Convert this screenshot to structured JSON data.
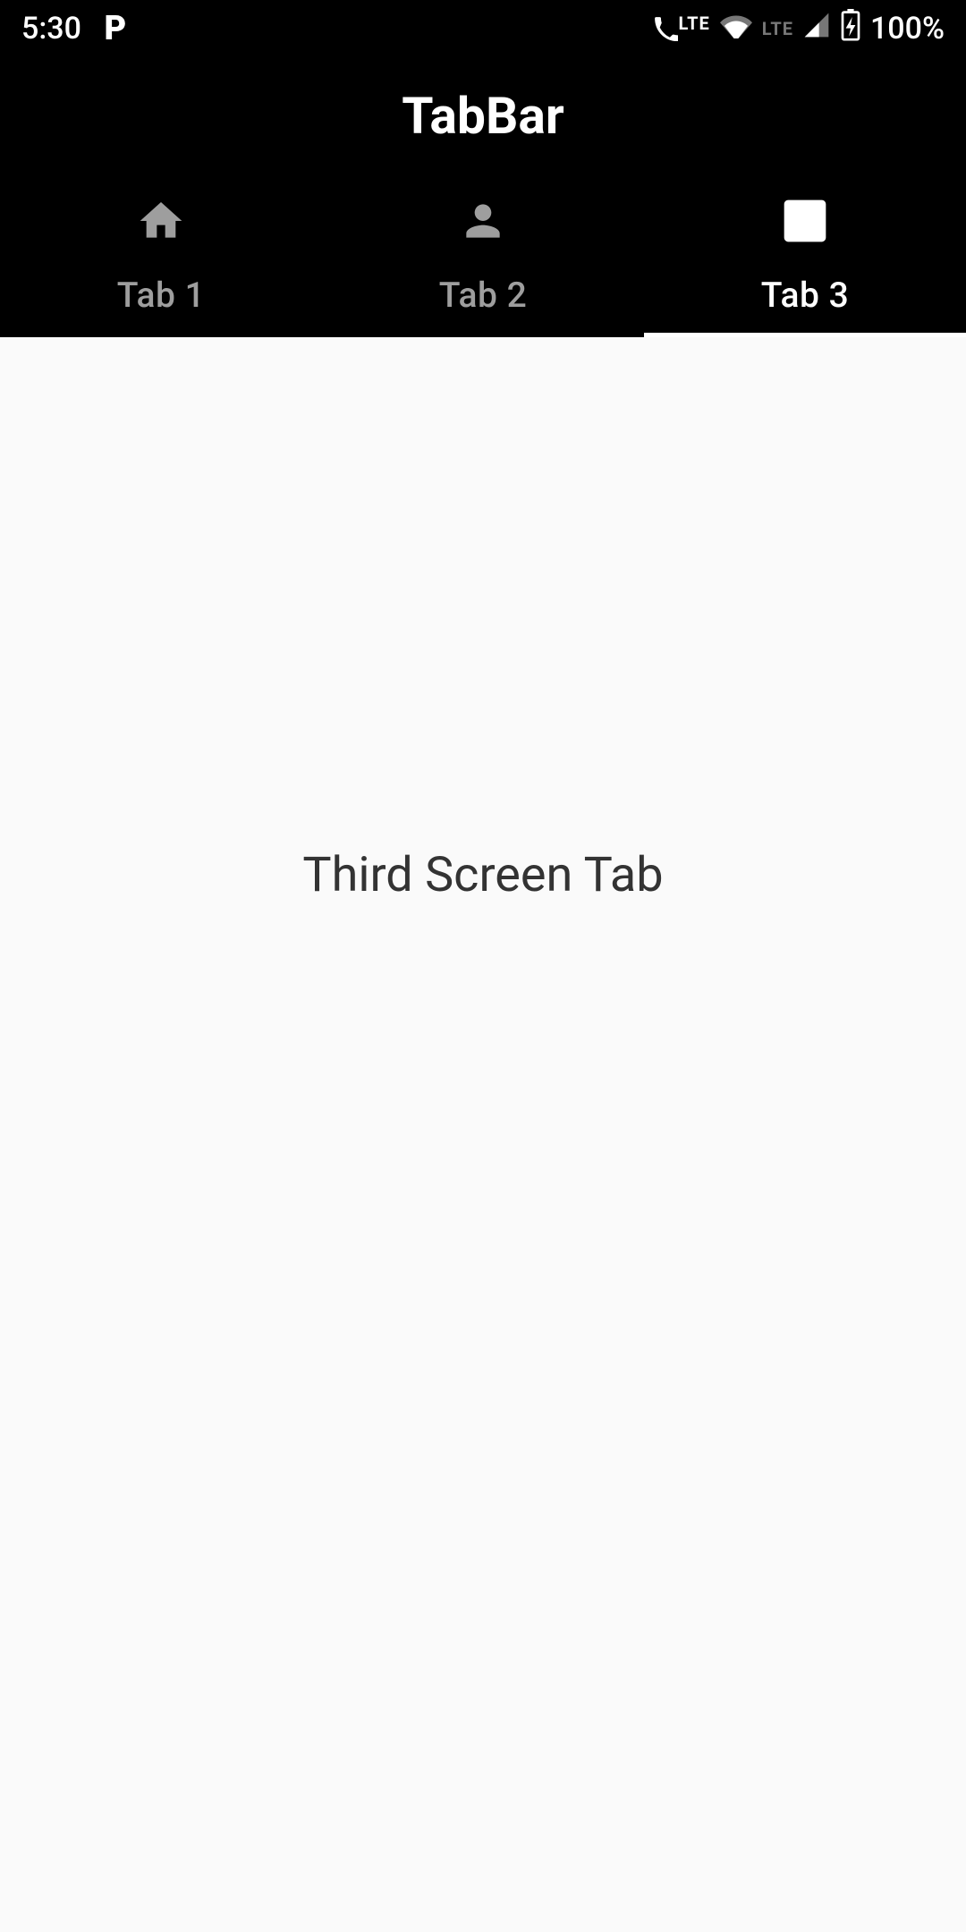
{
  "status": {
    "time": "5:30",
    "p_icon": "P",
    "lte1": "LTE",
    "lte2": "LTE",
    "battery": "100%"
  },
  "header": {
    "title": "TabBar"
  },
  "tabs": [
    {
      "label": "Tab 1",
      "icon": "home",
      "active": false
    },
    {
      "label": "Tab 2",
      "icon": "person",
      "active": false
    },
    {
      "label": "Tab 3",
      "icon": "bookmark-book",
      "active": true
    }
  ],
  "content": {
    "text": "Third Screen Tab"
  }
}
